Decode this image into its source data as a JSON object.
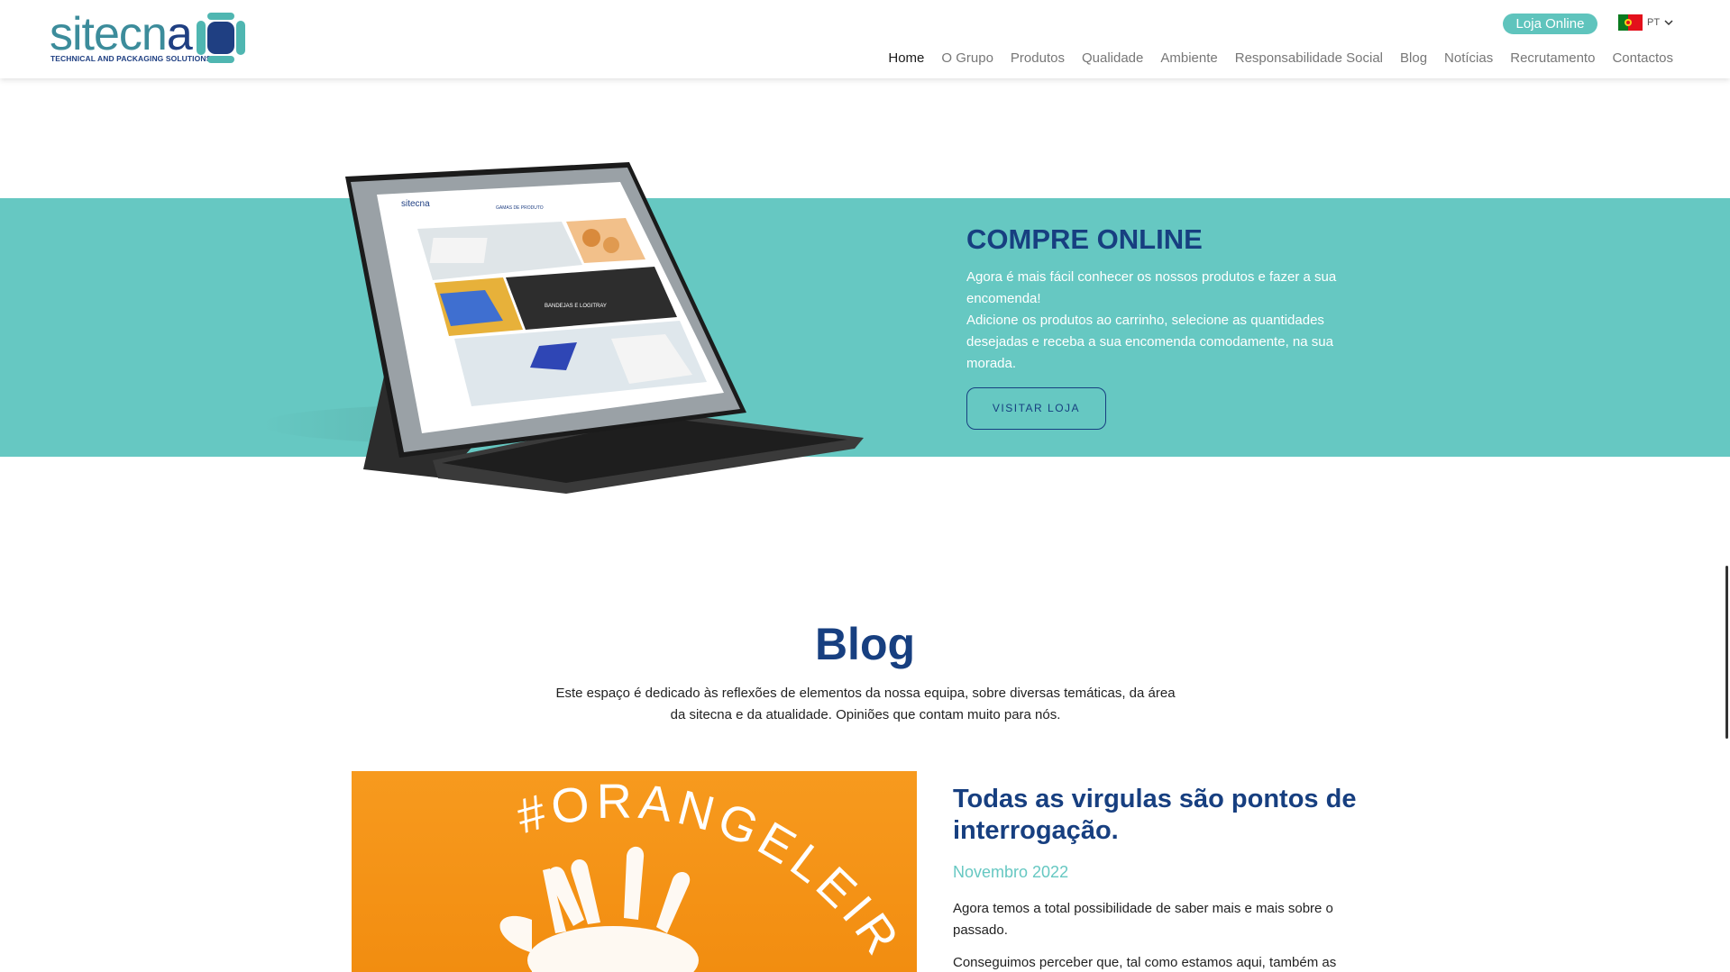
{
  "header": {
    "logo": {
      "word_light": "sitecn",
      "word_dark": "a",
      "tagline": "TECHNICAL AND PACKAGING SOLUTIONS"
    },
    "shop_button": "Loja Online",
    "language": {
      "code": "PT",
      "flag_icon": "portugal-flag-icon"
    },
    "nav": [
      {
        "label": "Home",
        "active": true
      },
      {
        "label": "O Grupo",
        "active": false
      },
      {
        "label": "Produtos",
        "active": false
      },
      {
        "label": "Qualidade",
        "active": false
      },
      {
        "label": "Ambiente",
        "active": false
      },
      {
        "label": "Responsabilidade Social",
        "active": false
      },
      {
        "label": "Blog",
        "active": false
      },
      {
        "label": "Notícias",
        "active": false
      },
      {
        "label": "Recrutamento",
        "active": false
      },
      {
        "label": "Contactos",
        "active": false
      }
    ]
  },
  "buy_online": {
    "title": "COMPRE ONLINE",
    "paragraph1": "Agora é mais fácil conhecer os nossos produtos e fazer a sua encomenda!",
    "paragraph2": "Adicione os produtos ao carrinho, selecione as quantidades desejadas e receba a sua encomenda comodamente, na sua morada.",
    "button": "VISITAR LOJA",
    "tablet_screen": {
      "logo": "sitecna",
      "heading": "GAMAS DE PRODUTO",
      "highlight": "BANDEJAS E LOGITRAY"
    }
  },
  "blog": {
    "title": "Blog",
    "intro_line1": "Este espaço é dedicado às reflexões de elementos da nossa equipa, sobre diversas temáticas, da área",
    "intro_line2": "da sitecna e da atualidade. Opiniões que contam muito para nós.",
    "post": {
      "image_text": "#ORANGELEIRIA",
      "title": "Todas as virgulas são pontos de interrogação.",
      "date": "Novembro 2022",
      "paragraph1": "Agora temos a total possibilidade de saber mais e mais sobre o passado.",
      "paragraph2": "Conseguimos perceber que, tal como estamos aqui, também as"
    }
  },
  "colors": {
    "brand_blue": "#173f80",
    "brand_teal": "#66c8c2",
    "orange": "#f39214"
  }
}
